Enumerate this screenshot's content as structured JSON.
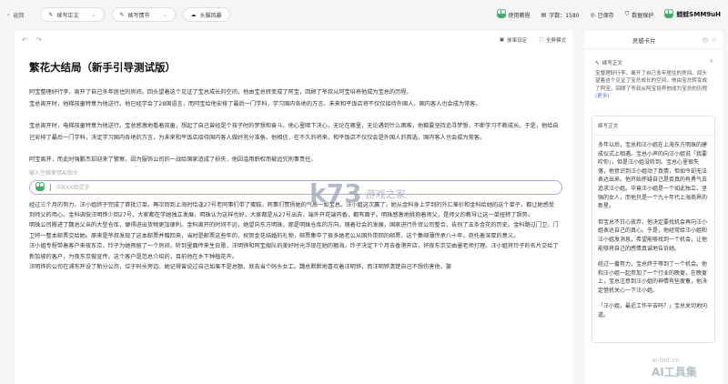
{
  "topbar": {
    "back_label": "返回",
    "pills": [
      {
        "label": "续写正文"
      },
      {
        "label": "续写情节"
      },
      {
        "label": "头脑风暴"
      }
    ],
    "tutorial": "使用教程",
    "word_count": "字数：1580",
    "saved": "已保存",
    "privacy": "数据保护",
    "username": "蛙蛙SMM9uH"
  },
  "editor": {
    "toolbar": {
      "story_settings": "故事设定",
      "fullscreen": "全屏模式"
    },
    "title": "繁花大结局（新手引导测试版）",
    "paragraphs": [
      "阿宝整理好行李，离开了自己多年居住的房间。回头望着这个见证了宝总成长的空间，他由宝总转变成了阿宝，回顾了爷叔从阿宝培养他成为宝总的历程。\n宝总离开时，他梯孩童特意为他送行。他已经学会了28国语言，而阿宝给他安排了最后一门学科，学习国内各地的方言。未来和平饭店将不仅仅接待外国人，国内客人也会成为常客。",
      "宝总离开时，电梯孩童特意为他送行。宝总感激地看着孩童，想起了自己曾经是个孩子时的梦想和奋斗。他心里暗下决心，无论在哪里，无论遇到什么困难，他都要坚持追寻梦想，不断学习不断成长。于是，他给自己安排了最后一门学科，决定学习国内各地的方言，为未来和平饭店接待国内客人做好充分准备。他相信，在不久的将来，和平饭店不仅仅会是外国人的首选，国内客人也会成为常客。",
      "阿宝离开，而此时强鹏杰却迎来了警察，因为服饰公司的一战给国家造成了损失，他因滥用职权而被追究刑事责任。"
    ],
    "hint": "输入空格使用AI指令",
    "prompt_placeholder": "问XXX给灵字",
    "paragraphs2": [
      "经过三个月的努力，汪小姐终于完成了首批订单。再次回到上海时恰逢27号老同事们带了蛋糕。同事们赞扬她的气质一如宝总。汪小姐这次赢了，她从金科身上学到的外汇差价和金科给她的这个单子，都让她感受到师父的用心。金科调侃汪明铧少回27号，大家都在学她独立发展，明珠认为这样也好，大家都是从27号出去，端外开花端内香，都有面子。明珠感激地挑抱着师父，是师父的教导让这一单扭转了颓势。\n明珠公司搬进了魏总父亲的大型仓库，便得进出货物更加便利。金科离开的时间不远，她望向东方明珠，那是明珠仓库的方向。随着社会的发展，国家进行外贸公司整合，告别了五条金花的历史。金科路过门卫，门卫将一整本邮票交给她。原来是爷叔发现了这本邮票并赠回来，当时是邮票这些年的，祝贺金花结婚的礼物，邮票集中了很多她老公从国外带回的邮票，这个集邮薄传承八十年，奇托着深厚的意义。\n汪小姐专程带着客户来夜东京，玲子为她预留了一个房间，听到里面传来生日歌，汪明铧和阿宝舰队的美好时光浮现在她的额海。玲子决定下个月去香港开店，将夜东京交由墨老师打理。汪小姐将玲子的名片交给了新加坡的客户，为夜东京做宣传。这个客户是范总介绍的，目前他在乡下种植花卉。\n汪明铧的公司在浦东开设了新分公司，位于码头旁边。她记得曾说过自己如果不是总额，就去当个码头女工。魏总默默地喜欢着汪明铧，而汪明铧清楚自己不想伤害他，娶"
    ]
  },
  "panel": {
    "title": "灵感卡片",
    "card1": {
      "label": "续写正文",
      "text": "宝整理好行李，离开了自己多年居住的房间。回头望着这个见证了宝总成长的空间，他由宝总转变成了阿宝，回顾了爷叔从阿宝培养他成为宝总的历程",
      "more": "(更多)"
    },
    "card2": {
      "label": "续写正文",
      "paragraphs": [
        "多年以后，宝总和汪小姐在上海东方明珠的建成仪式上相遇。宝总小声的向汪小姐说「我要吹你」，但是汪小姐没听到。宝总心里很失落，他意识到汪小姐动了真情，但如今却无法表达出来。他开始怀疑自己是否真的有勇气去追求汪小姐。毕竟汪小姐是一个如此独立、坚强的女人，而他只是一个九十年代上海商界的新星。",
        "但宝总不甘心放弃，他决定要找机会再向汪小姐表达自己的真心。于是，他经常给汪小姐和汪小姐发消息，希望能够找到一个机会，让他能够将自己的感情真诚地告诉她。",
        "经过一番努力，宝总终于等到了一个机会。他和汪小姐一起参加了一个行业的晚宴，在晚宴上，宝总注意到汪小姐的神情有些疲惫，他决定借机关心一下汪小姐。",
        "「汪小姐，最近工作辛苦吗？」宝总关切地问道。"
      ]
    }
  },
  "watermark": {
    "k73": "k73",
    "k73_sub": "游戏之家",
    "site": "ai-bot.cn",
    "brand": "AI工具集"
  },
  "colors": {
    "accent": "#5a6ee0",
    "prompt_border": "#b9a6ea",
    "frog_green": "#3fae6a"
  }
}
